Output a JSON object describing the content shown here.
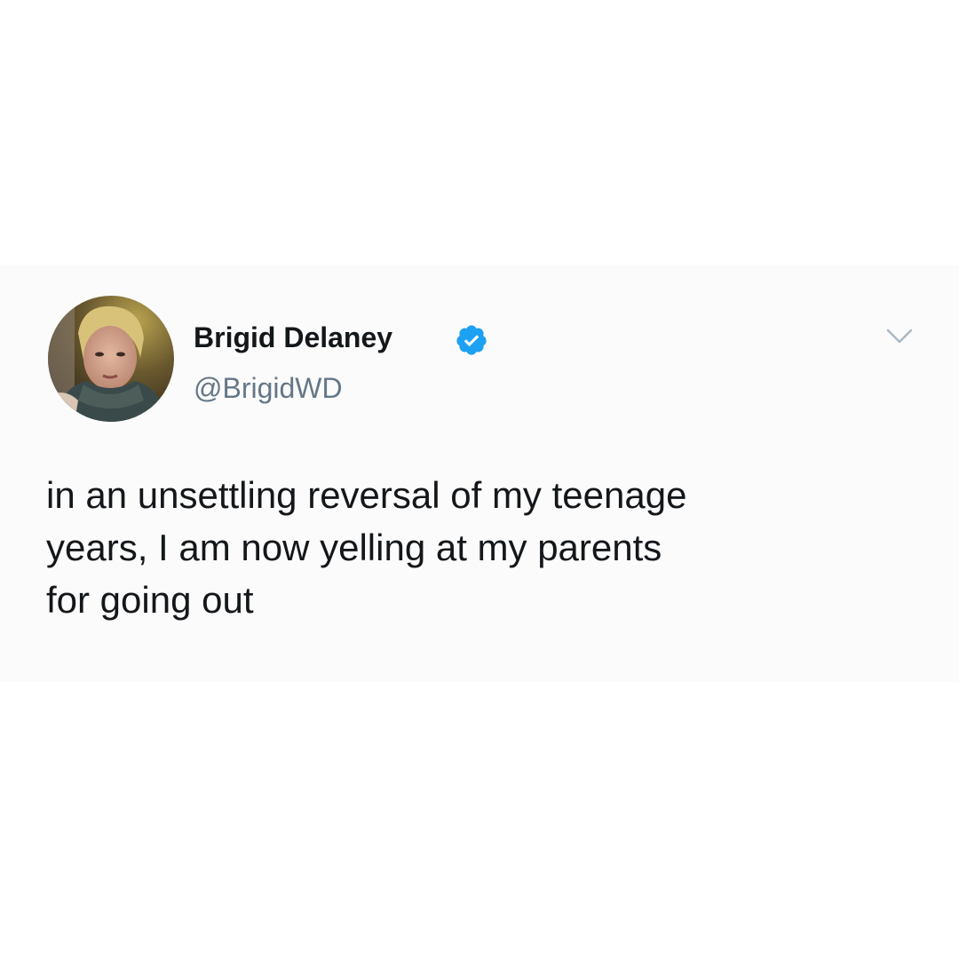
{
  "tweet": {
    "author": {
      "display_name": "Brigid Delaney",
      "handle": "@BrigidWD",
      "verified": true,
      "verified_icon": "verified-badge-icon",
      "avatar": "profile-photo"
    },
    "menu_icon": "chevron-down-icon",
    "text_lines": [
      "in an unsettling reversal of my teenage",
      "years, I am now yelling at my parents",
      "for going out"
    ]
  },
  "colors": {
    "verified_blue": "#1da1f2",
    "name_text": "#14171a",
    "handle_text": "#657786",
    "chevron": "#aab8c2"
  }
}
